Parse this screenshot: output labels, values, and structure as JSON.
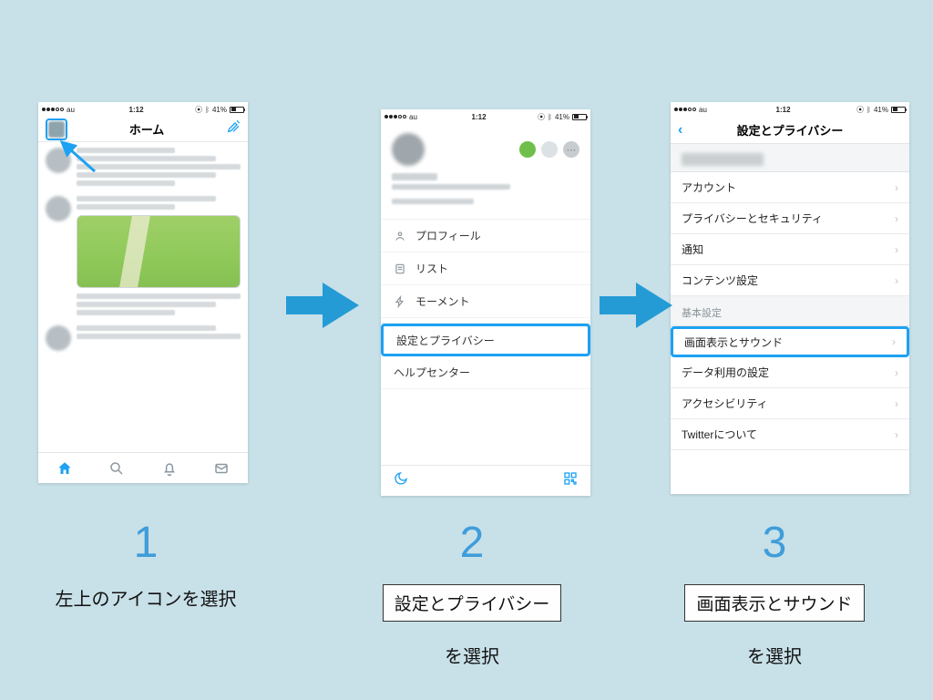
{
  "statusbar": {
    "carrier": "au",
    "time": "1:12",
    "battery": "41%"
  },
  "phone1": {
    "title": "ホーム"
  },
  "phone2": {
    "menu": {
      "profile": "プロフィール",
      "list": "リスト",
      "moments": "モーメント",
      "settings": "設定とプライバシー",
      "help": "ヘルプセンター"
    }
  },
  "phone3": {
    "title": "設定とプライバシー",
    "rows": {
      "account": "アカウント",
      "privacy": "プライバシーとセキュリティ",
      "notifications": "通知",
      "content": "コンテンツ設定",
      "section_basic": "基本設定",
      "display_sound": "画面表示とサウンド",
      "data_usage": "データ利用の設定",
      "accessibility": "アクセシビリティ",
      "about": "Twitterについて"
    }
  },
  "steps": {
    "n1": "1",
    "t1": "左上のアイコンを選択",
    "n2": "2",
    "t2_box": "設定とプライバシー",
    "t2_sub": "を選択",
    "n3": "3",
    "t3_box": "画面表示とサウンド",
    "t3_sub": "を選択"
  }
}
